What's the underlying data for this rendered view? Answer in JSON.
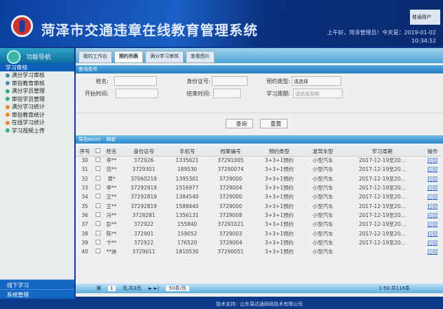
{
  "header": {
    "title": "菏泽市交通违章在线教育管理系统",
    "greeting": "上午好，菏泽管理员！今天是：2019-01-02",
    "time": "10:34:52",
    "user_button": "普通用户"
  },
  "sidebar": {
    "title": "功能导航",
    "group": "学习审核",
    "items": [
      "满分学习审核",
      "审验教育审核",
      "满分学员管理",
      "审验学员管理",
      "满分学习统计",
      "审验教育统计",
      "在线学习统计",
      "学习视频上传"
    ],
    "bottom": [
      "线下学习",
      "系统管理"
    ]
  },
  "tabs": [
    "我的工作台",
    "预约列表",
    "满分学习审核",
    "查看图片"
  ],
  "query": {
    "title": "查询条件",
    "name_label": "姓名:",
    "id_label": "身份证号:",
    "type_label": "预约类型:",
    "type_value": "请选择",
    "start_label": "开始时间:",
    "end_label": "结束时间:",
    "period_label": "学习周期:",
    "period_placeholder": "请选择周期",
    "search": "查询",
    "reset": "重置"
  },
  "toolbar": {
    "export": "导出excel",
    "refresh": "刷新"
  },
  "table": {
    "columns": [
      "序号",
      "",
      "姓名",
      "身份证号",
      "手机号",
      "档案编号",
      "预约类型",
      "准驾车型",
      "学习周期",
      "操作"
    ],
    "rows": [
      [
        "30",
        "李**",
        "372926",
        "1335621",
        "37291005",
        "3+3+1预约",
        "小型汽车",
        "2017-12-19至20...",
        "打印"
      ],
      [
        "31",
        "范**",
        "3729301",
        "189530",
        "37290074",
        "3+3+1预约",
        "小型汽车",
        "2017-12-19至20...",
        "打印"
      ],
      [
        "32",
        "黄*",
        "37060219",
        "1395301",
        "3729000",
        "3+3+1预约",
        "小型汽车",
        "2017-12-19至20...",
        "打印"
      ],
      [
        "33",
        "李**",
        "37292919",
        "1516977",
        "3729004",
        "3+3+1预约",
        "小型汽车",
        "2017-12-19至20...",
        "打印"
      ],
      [
        "34",
        "王**",
        "37292819",
        "1384540",
        "3729000",
        "3+3+1预约",
        "小型汽车",
        "2017-12-19至20...",
        "打印"
      ],
      [
        "35",
        "王**",
        "37292819",
        "1588440",
        "3729000",
        "3+3+1预约",
        "小型汽车",
        "2017-12-19至20...",
        "打印"
      ],
      [
        "36",
        "冯**",
        "3728281",
        "1356131",
        "3729008",
        "3+3+1预约",
        "小型汽车",
        "2017-12-19至20...",
        "打印"
      ],
      [
        "37",
        "彭**",
        "372922",
        "155840",
        "37291021",
        "3+3+1预约",
        "小型汽车",
        "2017-12-19至20...",
        "打印"
      ],
      [
        "38",
        "陈**",
        "372901",
        "159052",
        "3729003",
        "3+3+1预约",
        "小型汽车",
        "2017-12-19至20...",
        "打印"
      ],
      [
        "39",
        "卞**",
        "372922",
        "176520",
        "3729004",
        "3+3+1预约",
        "小型汽车",
        "2017-12-19至20...",
        "打印"
      ],
      [
        "40",
        "**迪",
        "3729011",
        "1810530",
        "37290051",
        "3+3+1预约",
        "小型汽车",
        "",
        "打印"
      ]
    ]
  },
  "pager": {
    "page_prefix": "第",
    "page": "1",
    "page_suffix": "页,共3页",
    "page_size": "50条/页",
    "info": "1-50 共116条"
  },
  "footer": "技术支持：山东易达通网络技术有限公司"
}
